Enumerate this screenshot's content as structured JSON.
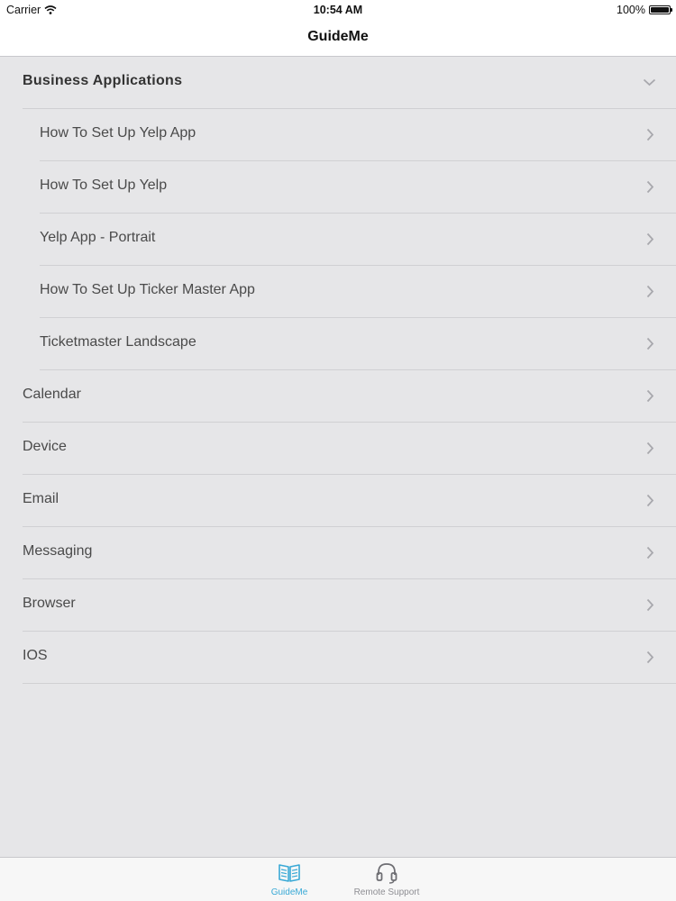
{
  "status_bar": {
    "carrier": "Carrier",
    "time": "10:54 AM",
    "battery": "100%",
    "battery_level": 1.0
  },
  "nav": {
    "title": "GuideMe"
  },
  "list": {
    "header": {
      "label": "Business Applications",
      "icon": "chevron-down-icon"
    },
    "sub_items": [
      {
        "label": "How To Set Up Yelp App"
      },
      {
        "label": "How To Set Up Yelp"
      },
      {
        "label": "Yelp App - Portrait"
      },
      {
        "label": "How To Set Up Ticker Master App"
      },
      {
        "label": "Ticketmaster Landscape"
      }
    ],
    "categories": [
      {
        "label": "Calendar"
      },
      {
        "label": "Device"
      },
      {
        "label": "Email"
      },
      {
        "label": "Messaging"
      },
      {
        "label": "Browser"
      },
      {
        "label": "IOS"
      }
    ]
  },
  "tab_bar": {
    "tabs": [
      {
        "label": "GuideMe",
        "icon": "book-icon",
        "selected": true
      },
      {
        "label": "Remote Support",
        "icon": "headset-icon",
        "selected": false
      }
    ]
  },
  "colors": {
    "accent": "#39a9d6",
    "background": "#e6e6e8",
    "text": "#4a4a4a",
    "separator": "#d0d0d3"
  }
}
